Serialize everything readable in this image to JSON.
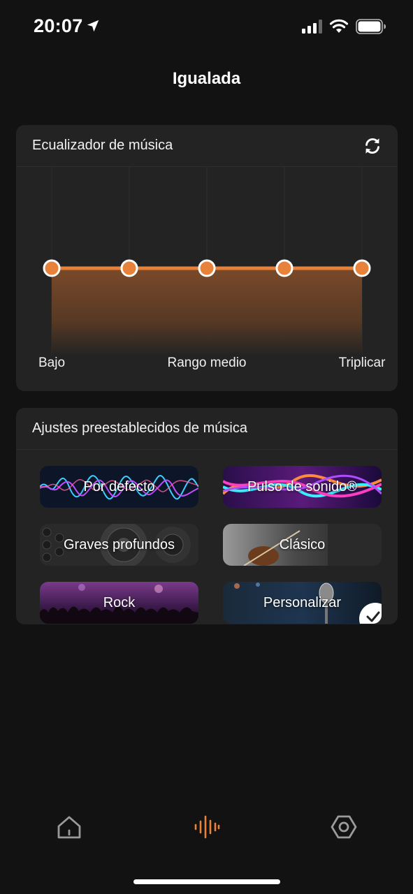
{
  "status_bar": {
    "time": "20:07",
    "icons": [
      "location-arrow-icon",
      "cellular-signal-icon",
      "wifi-icon",
      "battery-icon"
    ]
  },
  "header": {
    "title": "Igualada"
  },
  "equalizer": {
    "title": "Ecualizador de música",
    "reset_icon": "refresh-icon",
    "accent_color": "#E8813A",
    "band_levels": [
      0,
      0,
      0,
      0,
      0
    ],
    "labels": {
      "low": "Bajo",
      "mid": "Rango medio",
      "high": "Triplicar"
    }
  },
  "presets": {
    "title": "Ajustes preestablecidos de música",
    "items": [
      {
        "label": "Por defecto",
        "selected": false
      },
      {
        "label": "Pulso de sonido®",
        "selected": false
      },
      {
        "label": "Graves profundos",
        "selected": false
      },
      {
        "label": "Clásico",
        "selected": false
      },
      {
        "label": "Rock",
        "selected": false
      },
      {
        "label": "Personalizar",
        "selected": true
      }
    ]
  },
  "bottom_nav": {
    "items": [
      {
        "icon": "home-icon",
        "active": false
      },
      {
        "icon": "equalizer-waveform-icon",
        "active": true
      },
      {
        "icon": "settings-hexagon-icon",
        "active": false
      }
    ],
    "active_color": "#E8813A",
    "inactive_color": "#9A9A9A"
  }
}
